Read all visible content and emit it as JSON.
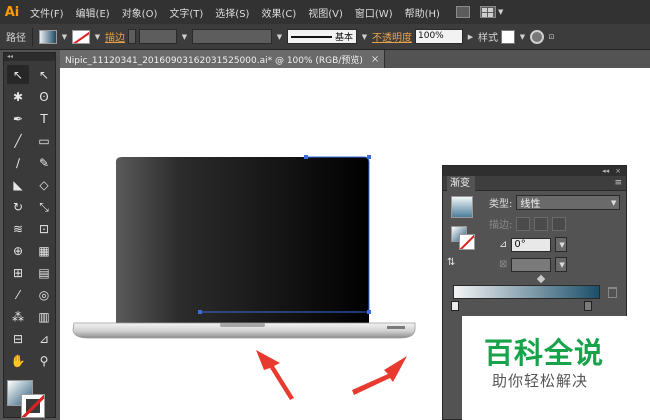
{
  "app": {
    "logo": "Ai"
  },
  "menubar": {
    "items": [
      "文件(F)",
      "编辑(E)",
      "对象(O)",
      "文字(T)",
      "选择(S)",
      "效果(C)",
      "视图(V)",
      "窗口(W)",
      "帮助(H)"
    ],
    "icons": [
      "bridge-icon",
      "arrange-documents-icon"
    ]
  },
  "controlbar": {
    "selection_label": "路径",
    "stroke_label": "描边",
    "stroke_style": "基本",
    "opacity_label": "不透明度",
    "opacity_value": "100%",
    "style_label": "样式"
  },
  "document": {
    "tab_title": "Nipic_11120341_20160903162031525000.ai* @ 100% (RGB/预览)",
    "close": "×"
  },
  "tools": [
    {
      "name": "selection-tool",
      "glyph": "↖"
    },
    {
      "name": "direct-selection-tool",
      "glyph": "↖"
    },
    {
      "name": "magic-wand-tool",
      "glyph": "✱"
    },
    {
      "name": "lasso-tool",
      "glyph": "ʘ"
    },
    {
      "name": "pen-tool",
      "glyph": "✒"
    },
    {
      "name": "type-tool",
      "glyph": "T"
    },
    {
      "name": "line-tool",
      "glyph": "╱"
    },
    {
      "name": "rectangle-tool",
      "glyph": "▭"
    },
    {
      "name": "paintbrush-tool",
      "glyph": "∕"
    },
    {
      "name": "pencil-tool",
      "glyph": "✎"
    },
    {
      "name": "blob-brush-tool",
      "glyph": "◣"
    },
    {
      "name": "eraser-tool",
      "glyph": "◇"
    },
    {
      "name": "rotate-tool",
      "glyph": "↻"
    },
    {
      "name": "scale-tool",
      "glyph": "⤡"
    },
    {
      "name": "warp-tool",
      "glyph": "≋"
    },
    {
      "name": "free-transform-tool",
      "glyph": "⊡"
    },
    {
      "name": "shape-builder-tool",
      "glyph": "⊕"
    },
    {
      "name": "perspective-grid-tool",
      "glyph": "▦"
    },
    {
      "name": "mesh-tool",
      "glyph": "⊞"
    },
    {
      "name": "gradient-tool",
      "glyph": "▤"
    },
    {
      "name": "eyedropper-tool",
      "glyph": "⁄"
    },
    {
      "name": "blend-tool",
      "glyph": "◎"
    },
    {
      "name": "symbol-sprayer-tool",
      "glyph": "⁂"
    },
    {
      "name": "column-graph-tool",
      "glyph": "▥"
    },
    {
      "name": "artboard-tool",
      "glyph": "⊟"
    },
    {
      "name": "slice-tool",
      "glyph": "⊿"
    },
    {
      "name": "hand-tool",
      "glyph": "✋"
    },
    {
      "name": "zoom-tool",
      "glyph": "⚲"
    }
  ],
  "gradient_panel": {
    "tab": "渐变",
    "type_label": "类型:",
    "type_value": "线性",
    "stroke_label": "描边:",
    "angle_value": "0°",
    "colors": {
      "start": "#f4f4f4",
      "end": "#1c4f6a"
    }
  },
  "watermark": {
    "title": "百科全说",
    "subtitle": "助你轻松解决"
  }
}
